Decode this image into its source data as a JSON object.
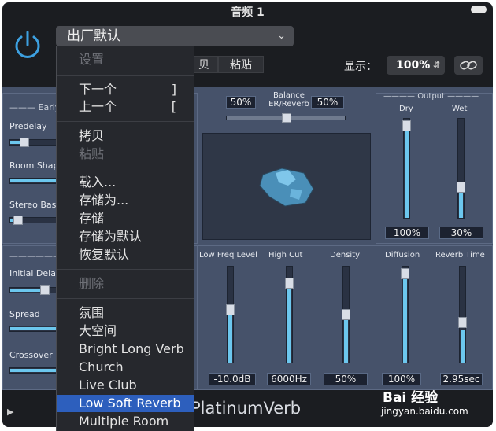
{
  "window": {
    "title": "音频 1"
  },
  "header": {
    "preset_value": "出厂默认",
    "copy_label": "贝",
    "paste_label": "粘贴",
    "show_label": "显示：",
    "zoom_value": "100%"
  },
  "menu": {
    "items": [
      {
        "label": "设置",
        "state": "disabled"
      },
      {
        "label": "下一个",
        "shortcut": "]"
      },
      {
        "label": "上一个",
        "shortcut": "["
      },
      {
        "label": "拷贝"
      },
      {
        "label": "粘贴",
        "state": "disabled"
      },
      {
        "label": "载入..."
      },
      {
        "label": "存储为..."
      },
      {
        "label": "存储"
      },
      {
        "label": "存储为默认"
      },
      {
        "label": "恢复默认"
      },
      {
        "label": "删除",
        "state": "disabled"
      },
      {
        "label": "氛围"
      },
      {
        "label": "大空间"
      },
      {
        "label": "Bright Long Verb"
      },
      {
        "label": "Church"
      },
      {
        "label": "Live Club"
      },
      {
        "label": "Low Soft Reverb",
        "state": "selected"
      },
      {
        "label": "Multiple Room"
      }
    ]
  },
  "plugin": {
    "brand": "PlatinumVerb",
    "early": {
      "section_label": "Early",
      "predelay_label": "Predelay",
      "room_shape_label": "Room Shap",
      "stereo_base_label": "Stereo Base"
    },
    "reflect": {
      "section_label": "R",
      "initial_delay_label": "Initial Delay",
      "spread_label": "Spread",
      "crossover_label": "Crossover"
    },
    "balance": {
      "label_line1": "Balance",
      "label_line2": "ER/Reverb",
      "left_value": "50%",
      "right_value": "50%",
      "position": 0.5
    },
    "output": {
      "section_label": "Output",
      "dry_label": "Dry",
      "wet_label": "Wet",
      "dry_value": "100%",
      "wet_value": "30%",
      "dry_level": 0.95,
      "wet_level": 0.3
    },
    "reverb": {
      "low_freq_label": "Low Freq Level",
      "high_cut_label": "High Cut",
      "density_label": "Density",
      "diffusion_label": "Diffusion",
      "reverb_time_label": "Reverb Time",
      "low_freq_value": "-10.0dB",
      "high_cut_value": "6000Hz",
      "density_value": "50%",
      "diffusion_value": "100%",
      "reverb_time_value": "2.95sec",
      "low_freq_level": 0.5,
      "high_cut_level": 0.75,
      "density_level": 0.5,
      "diffusion_level": 0.97,
      "reverb_time_level": 0.4
    }
  },
  "watermark": {
    "brand": "Bai 经验",
    "url": "jingyan.baidu.com"
  },
  "colors": {
    "accent": "#6cc7ee",
    "panel": "#46526a",
    "selection": "#2d5fbd"
  }
}
